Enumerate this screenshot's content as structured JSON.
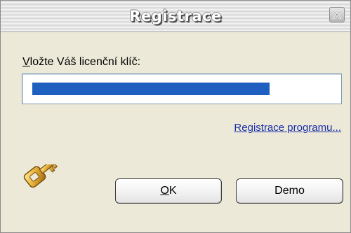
{
  "window": {
    "title": "Registrace",
    "close_icon": "close-x-icon"
  },
  "form": {
    "prompt_label_first": "V",
    "prompt_label_rest": "ložte Váš licenční klíč:",
    "license_value": "",
    "link_text": "Registrace programu..."
  },
  "buttons": {
    "ok_first": "O",
    "ok_rest": "K",
    "demo": "Demo"
  },
  "icons": {
    "key": "key-icon"
  },
  "colors": {
    "selection": "#1f5fbf",
    "link": "#1a2fa8",
    "dialog_bg": "#ece9d8",
    "key_gold": "#e8b33a"
  }
}
